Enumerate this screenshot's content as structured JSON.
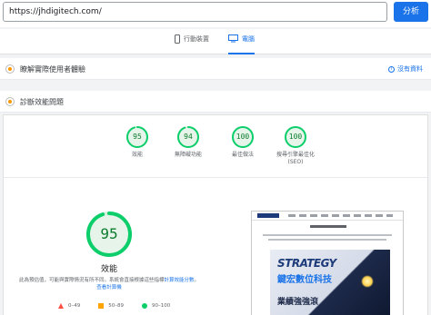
{
  "search": {
    "url_value": "https://jhdigitech.com/",
    "analyze_label": "分析"
  },
  "device_tabs": [
    {
      "label": "行動裝置",
      "active": false
    },
    {
      "label": "電腦",
      "active": true
    }
  ],
  "sections": {
    "real_user": {
      "title": "瞭解實際使用者體驗",
      "no_data": "沒有資料"
    },
    "diagnose": {
      "title": "診斷效能問題"
    }
  },
  "scores": [
    {
      "value": "95",
      "label": "效能",
      "fraction": 0.95
    },
    {
      "value": "94",
      "label": "無障礙功能",
      "fraction": 0.94
    },
    {
      "value": "100",
      "label": "最佳做法",
      "fraction": 1.0
    },
    {
      "value": "100",
      "label": "搜尋引擎最佳化",
      "label2": "(SEO)",
      "fraction": 1.0
    }
  ],
  "detail": {
    "score": "95",
    "score_fraction": 0.95,
    "label": "效能",
    "note_prefix": "此為預估值，可能與實際情況有所不同。系統會直接根據這些指標",
    "note_link": "計算效能分數",
    "note_sep": "。",
    "note_link2": "查看計算機"
  },
  "legend": [
    {
      "label": "0–49",
      "shape": "triangle",
      "color": "#ff4e42"
    },
    {
      "label": "50–89",
      "shape": "square",
      "color": "#ffa400"
    },
    {
      "label": "90–100",
      "shape": "circle",
      "color": "#0cce6b"
    }
  ],
  "screenshot_preview": {
    "hero_line1": "STRATEGY",
    "hero_line2": "鍵宏數位科技",
    "hero_line3": "業績強強滾"
  },
  "colors": {
    "accent": "#1a73e8",
    "good": "#0cce6b",
    "good_text": "#0c7c2c"
  }
}
